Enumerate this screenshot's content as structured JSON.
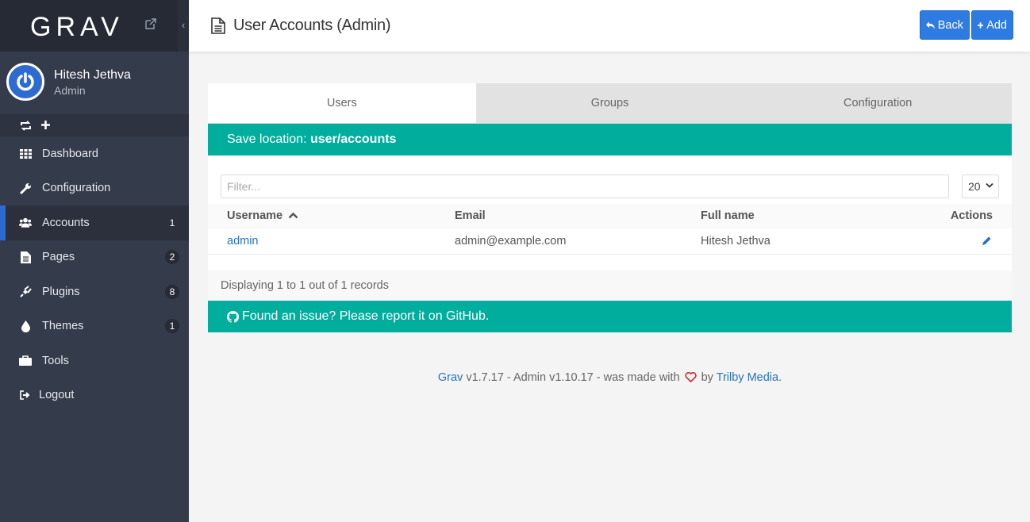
{
  "sidebar": {
    "logo": "GRAV",
    "collapse_glyph": "‹",
    "user": {
      "name": "Hitesh Jethva",
      "role": "Admin"
    },
    "items": [
      {
        "label": "Dashboard",
        "badge": "",
        "icon": "dashboard-icon"
      },
      {
        "label": "Configuration",
        "badge": "",
        "icon": "wrench-icon"
      },
      {
        "label": "Accounts",
        "badge": "1",
        "icon": "users-icon",
        "active": true
      },
      {
        "label": "Pages",
        "badge": "2",
        "icon": "file-icon"
      },
      {
        "label": "Plugins",
        "badge": "8",
        "icon": "plug-icon"
      },
      {
        "label": "Themes",
        "badge": "1",
        "icon": "tint-icon"
      },
      {
        "label": "Tools",
        "badge": "",
        "icon": "briefcase-icon"
      },
      {
        "label": "Logout",
        "badge": "",
        "icon": "sign-out-icon"
      }
    ]
  },
  "header": {
    "title": "User Accounts (Admin)",
    "back_label": "Back",
    "add_label": "Add"
  },
  "tabs": [
    {
      "label": "Users",
      "active": true
    },
    {
      "label": "Groups",
      "active": false
    },
    {
      "label": "Configuration",
      "active": false
    }
  ],
  "notice": {
    "prefix": "Save location: ",
    "location": "user/accounts"
  },
  "table": {
    "filter_placeholder": "Filter...",
    "per_page": "20",
    "columns": [
      "Username",
      "Email",
      "Full name",
      "Actions"
    ],
    "rows": [
      {
        "username": "admin",
        "email": "admin@example.com",
        "fullname": "Hitesh Jethva"
      }
    ],
    "summary": "Displaying 1 to 1 out of 1 records"
  },
  "github_notice": "Found an issue? Please report it on GitHub.",
  "footer": {
    "grav": "Grav",
    "version_text": " v1.7.17 - Admin v1.10.17 - was made with ",
    "by": " by ",
    "trilby": "Trilby Media."
  },
  "colors": {
    "accent": "#2e7be2",
    "teal": "#01ae9d",
    "sidebar": "#343b4a"
  }
}
